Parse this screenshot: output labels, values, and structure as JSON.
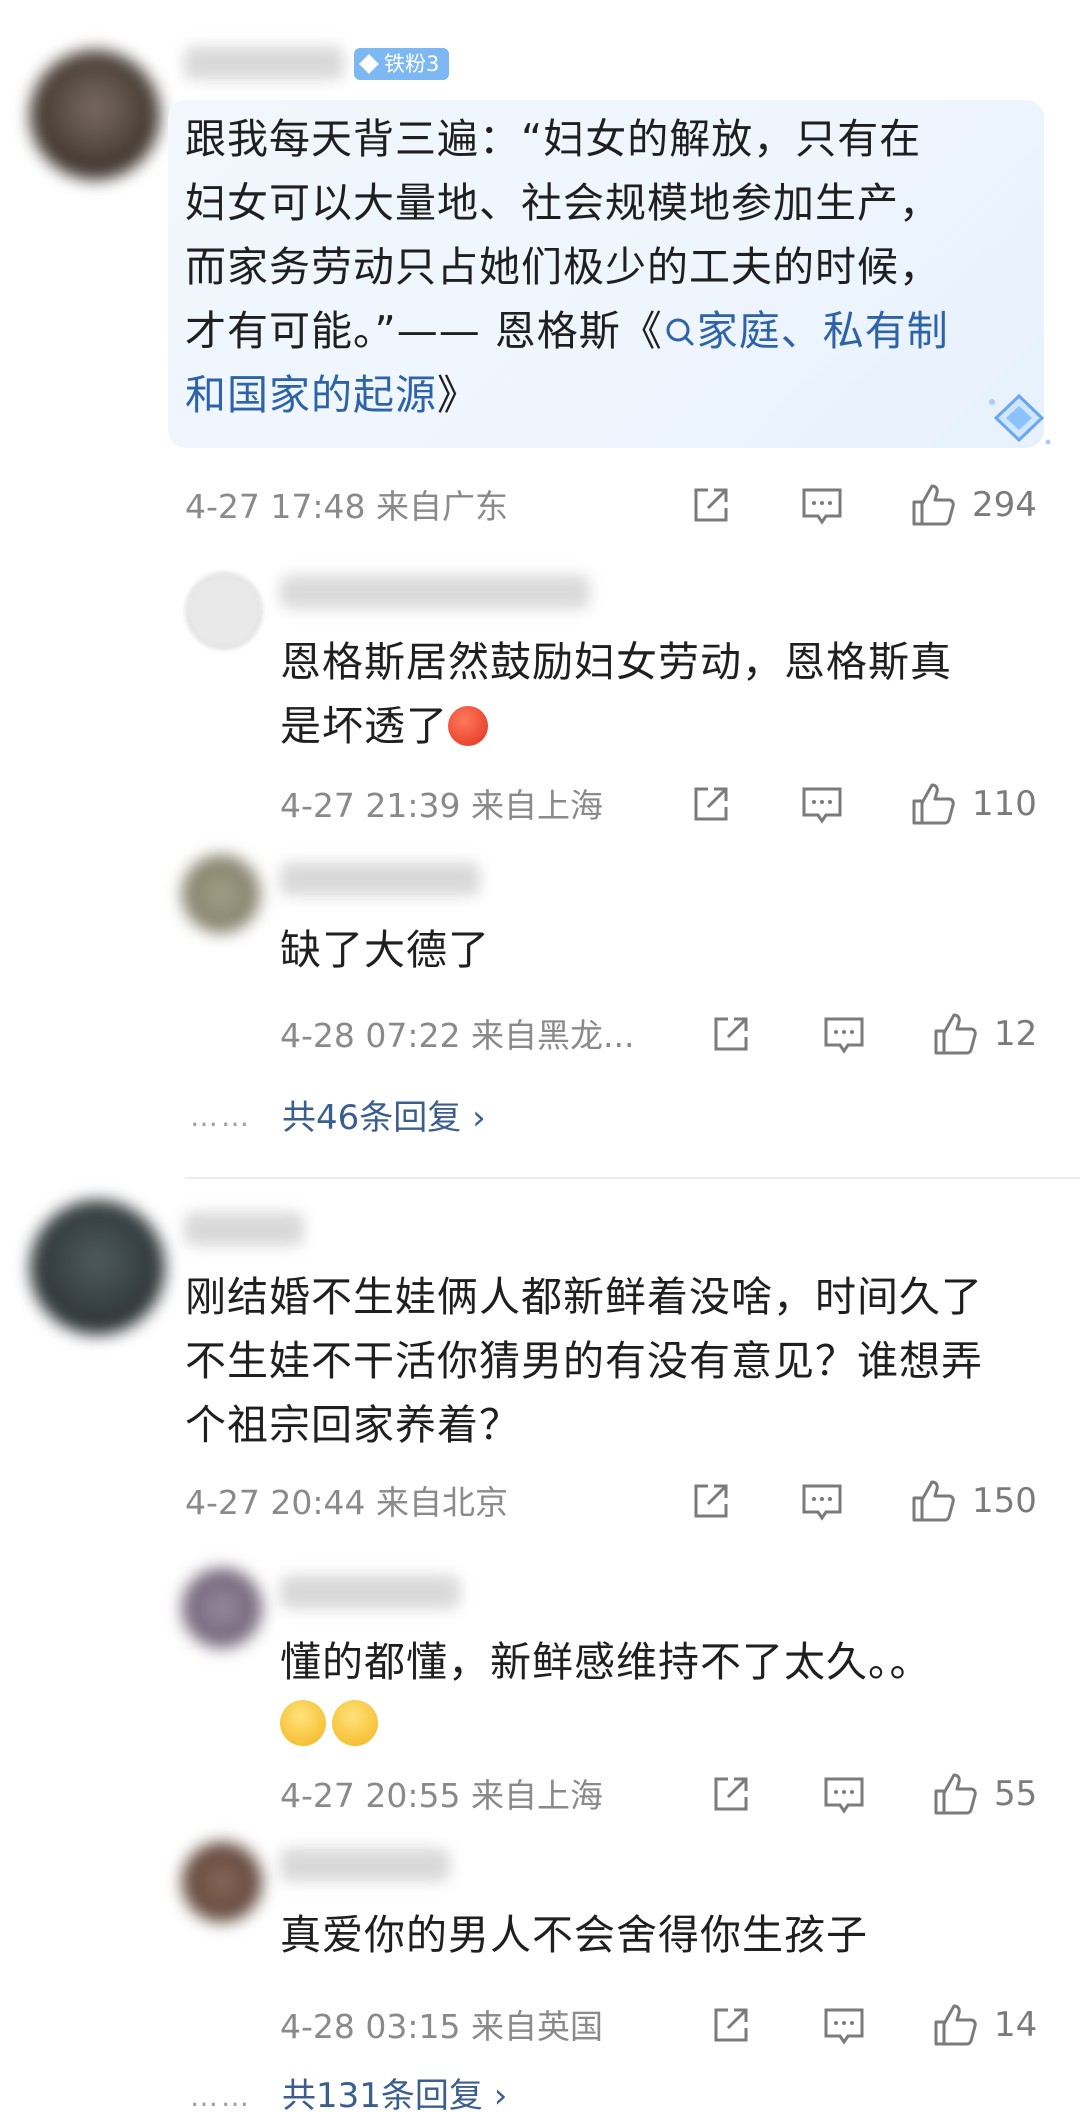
{
  "comments": [
    {
      "badge": "铁粉3",
      "text_lines": [
        "跟我每天背三遍：“妇女的解放，只有在",
        "妇女可以大量地、社会规模地参加生产，",
        "而家务劳动只占她们极少的工夫的时候，"
      ],
      "line4_prefix": "才有可能。”—— 恩格斯《",
      "link_part1": "家庭、私有制",
      "link_part2": "和国家的起源",
      "line5_suffix": "》",
      "time": "4-27 17:48",
      "location": "来自广东",
      "likes": "294"
    },
    {
      "text_lines": [
        "恩格斯居然鼓励妇女劳动，恩格斯真",
        "是坏透了"
      ],
      "time": "4-27 21:39",
      "location": "来自上海",
      "likes": "110"
    },
    {
      "text": "缺了大德了",
      "time": "4-28 07:22",
      "location": "来自黑龙...",
      "likes": "12"
    },
    {
      "text_lines": [
        "刚结婚不生娃俩人都新鲜着没啥，时间久了",
        "不生娃不干活你猜男的有没有意见？谁想弄",
        "个祖宗回家养着？"
      ],
      "time": "4-27 20:44",
      "location": "来自北京",
      "likes": "150"
    },
    {
      "text": "懂的都懂，新鲜感维持不了太久。。",
      "time": "4-27 20:55",
      "location": "来自上海",
      "likes": "55"
    },
    {
      "text": "真爱你的男人不会舍得你生孩子",
      "time": "4-28 03:15",
      "location": "来自英国",
      "likes": "14"
    }
  ],
  "reply_links": [
    "共46条回复 ›",
    "共131条回复 ›"
  ],
  "dots": "……",
  "colors": {
    "link": "#2e63a8",
    "meta": "#8a8a8a",
    "badge": "#7db8f2"
  },
  "icons": [
    "share-icon",
    "comment-icon",
    "like-icon",
    "search-icon",
    "diamond-icon"
  ]
}
